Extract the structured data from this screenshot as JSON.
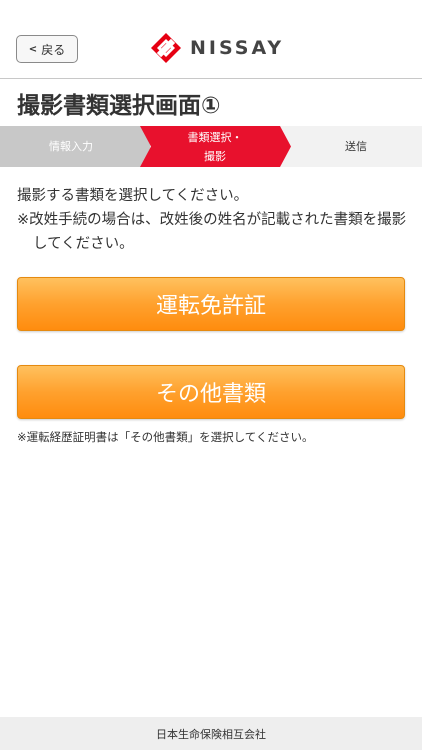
{
  "header": {
    "back_label": "戻る",
    "logo_text": "NISSAY",
    "logo_color": "#e60012"
  },
  "page": {
    "title": "撮影書類選択画面①"
  },
  "steps": [
    {
      "label": "情報入力",
      "state": "done"
    },
    {
      "label_line1": "書類選択・",
      "label_line2": "撮影",
      "state": "current"
    },
    {
      "label": "送信",
      "state": "upcoming"
    }
  ],
  "colors": {
    "step_done": "#c8c8c8",
    "step_current": "#e8112d",
    "step_upcoming": "#f2f2f2",
    "button_orange": "#ff9a1f"
  },
  "instructions": {
    "line1": "撮影する書類を選択してください。",
    "line2": "※改姓手続の場合は、改姓後の姓名が記載された書類を撮影してください。"
  },
  "buttons": {
    "license": "運転免許証",
    "other": "その他書類"
  },
  "footnote": "※運転経歴証明書は「その他書類」を選択してください。",
  "footer": {
    "company": "日本生命保険相互会社"
  }
}
